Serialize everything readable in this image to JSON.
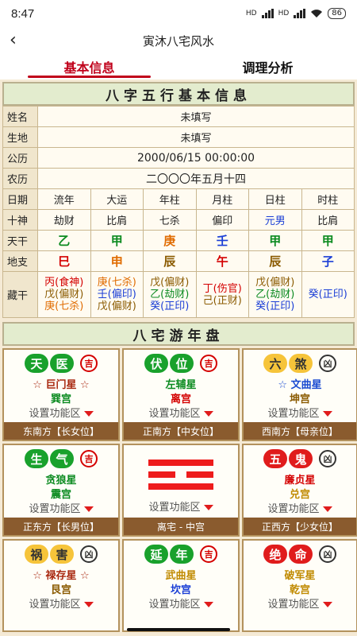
{
  "status": {
    "time": "8:47",
    "signal1": "HD",
    "signal2": "HD",
    "battery": "86"
  },
  "nav": {
    "back_icon": "chevron-left-icon",
    "title": "寅沐八宅风水"
  },
  "tabs": [
    {
      "label": "基本信息"
    },
    {
      "label": "调理分析"
    }
  ],
  "bazi": {
    "header": "八字五行基本信息",
    "name_label": "姓名",
    "name_value": "未填写",
    "birthplace_label": "生地",
    "birthplace_value": "未填写",
    "solar_label": "公历",
    "solar_value": "2000/06/15 00:00:00",
    "lunar_label": "农历",
    "lunar_value": "二〇〇〇年五月十四",
    "cols": [
      "流年",
      "大运",
      "年柱",
      "月柱",
      "日柱",
      "时柱"
    ],
    "rows": {
      "date_label": "日期",
      "shishen_label": "十神",
      "shishen": [
        "劫财",
        "比肩",
        "七杀",
        "偏印",
        "元男",
        "比肩"
      ],
      "tiangan_label": "天干",
      "tiangan": [
        "乙",
        "甲",
        "庚",
        "壬",
        "甲",
        "甲"
      ],
      "dizhi_label": "地支",
      "dizhi": [
        "巳",
        "申",
        "辰",
        "午",
        "辰",
        "子"
      ],
      "canggan_label": "藏干",
      "canggan": [
        [
          "丙(食神)",
          "戊(偏财)",
          "庚(七杀)"
        ],
        [
          "庚(七杀)",
          "壬(偏印)",
          "戊(偏财)"
        ],
        [
          "戊(偏财)",
          "乙(劫财)",
          "癸(正印)"
        ],
        [
          "丁(伤官)",
          "己(正财)"
        ],
        [
          "戊(偏财)",
          "乙(劫财)",
          "癸(正印)"
        ],
        [
          "癸(正印)"
        ]
      ]
    }
  },
  "bazhai": {
    "header": "八宅游年盘",
    "func_label": "设置功能区",
    "cells": [
      {
        "c1": "天",
        "c2": "医",
        "seal": "吉",
        "star": "巨门星",
        "palace": "巽宫",
        "dir": "东南方【长女位】"
      },
      {
        "c1": "伏",
        "c2": "位",
        "seal": "吉",
        "star": "左辅星",
        "palace": "离宫",
        "dir": "正南方【中女位】"
      },
      {
        "c1": "六",
        "c2": "煞",
        "seal": "凶",
        "star": "文曲星",
        "palace": "坤宫",
        "dir": "西南方【母亲位】"
      },
      {
        "c1": "生",
        "c2": "气",
        "seal": "吉",
        "star": "贪狼星",
        "palace": "震宫",
        "dir": "正东方【长男位】"
      },
      {
        "center_label": "离宅 - 中宫"
      },
      {
        "c1": "五",
        "c2": "鬼",
        "seal": "凶",
        "star": "廉贞星",
        "palace": "兑宫",
        "dir": "正西方【少女位】"
      },
      {
        "c1": "祸",
        "c2": "害",
        "seal": "凶",
        "star": "禄存星",
        "palace": "艮宫"
      },
      {
        "c1": "延",
        "c2": "年",
        "seal": "吉",
        "star": "武曲星",
        "palace": "坎宫"
      },
      {
        "c1": "绝",
        "c2": "命",
        "seal": "凶",
        "star": "破军星",
        "palace": "乾宫"
      }
    ],
    "star_mark": "☆"
  }
}
